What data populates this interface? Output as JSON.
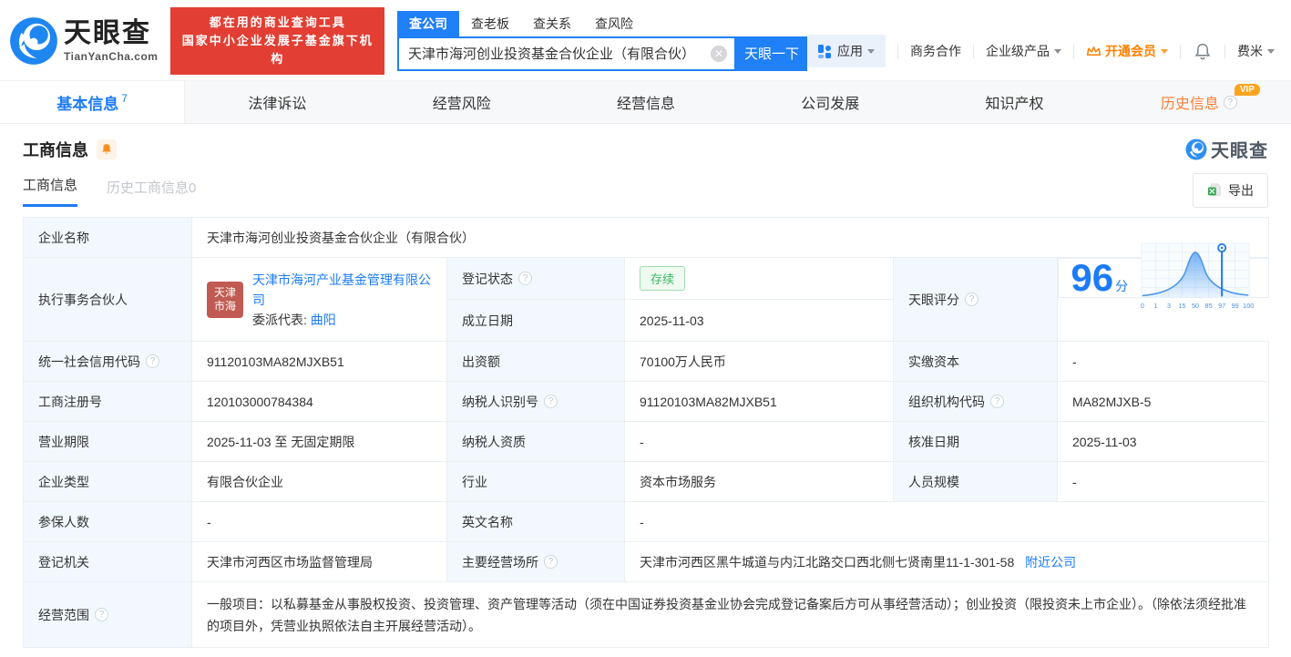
{
  "brand": {
    "name": "天眼查",
    "domain": "TianYanCha.com",
    "slogan_line1": "都在用的商业查询工具",
    "slogan_line2": "国家中小企业发展子基金旗下机构",
    "colors": {
      "primary": "#1c7bf8",
      "red": "#e23e33",
      "orange": "#ff8000",
      "green": "#3eb963"
    }
  },
  "search": {
    "tabs": [
      {
        "label": "查公司"
      },
      {
        "label": "查老板"
      },
      {
        "label": "查关系"
      },
      {
        "label": "查风险"
      }
    ],
    "value": "天津市海河创业投资基金合伙企业（有限合伙）",
    "button_label": "天眼一下"
  },
  "top_menu": {
    "apps": "应用",
    "cooperation": "商务合作",
    "enterprise_products": "企业级产品",
    "vip": "开通会员",
    "username": "费米"
  },
  "nav_tabs": [
    {
      "label": "基本信息",
      "badge": "7"
    },
    {
      "label": "法律诉讼"
    },
    {
      "label": "经营风险"
    },
    {
      "label": "经营信息"
    },
    {
      "label": "公司发展"
    },
    {
      "label": "知识产权"
    },
    {
      "label": "历史信息",
      "vip_badge": "VIP"
    }
  ],
  "section": {
    "title": "工商信息",
    "watermark": "天眼查",
    "subtab_active": "工商信息",
    "subtab_history": "历史工商信息0",
    "export_label": "导出"
  },
  "info": {
    "company_name_label": "企业名称",
    "company_name": "天津市海河创业投资基金合伙企业（有限合伙）",
    "partner_label": "执行事务合伙人",
    "partner_avatar_line1": "天津",
    "partner_avatar_line2": "市海",
    "partner_company": "天津市海河产业基金管理有限公司",
    "partner_rep_label": "委派代表:",
    "partner_rep_name": "曲阳",
    "reg_status_label": "登记状态",
    "reg_status": "存续",
    "establish_date_label": "成立日期",
    "establish_date": "2025-11-03",
    "score_label": "天眼评分",
    "score_value": "96",
    "score_unit": "分",
    "credit_code_label": "统一社会信用代码",
    "credit_code": "91120103MA82MJXB51",
    "capital_label": "出资额",
    "capital": "70100万人民币",
    "paid_capital_label": "实缴资本",
    "paid_capital": "-",
    "reg_number_label": "工商注册号",
    "reg_number": "120103000784384",
    "taxpayer_id_label": "纳税人识别号",
    "taxpayer_id": "91120103MA82MJXB51",
    "org_code_label": "组织机构代码",
    "org_code": "MA82MJXB-5",
    "business_term_label": "营业期限",
    "business_term": "2025-11-03 至 无固定期限",
    "taxpayer_quality_label": "纳税人资质",
    "taxpayer_quality": "-",
    "approval_date_label": "核准日期",
    "approval_date": "2025-11-03",
    "company_type_label": "企业类型",
    "company_type": "有限合伙企业",
    "industry_label": "行业",
    "industry": "资本市场服务",
    "staff_size_label": "人员规模",
    "staff_size": "-",
    "insured_label": "参保人数",
    "insured": "-",
    "english_name_label": "英文名称",
    "english_name": "-",
    "reg_authority_label": "登记机关",
    "reg_authority": "天津市河西区市场监督管理局",
    "business_address_label": "主要经营场所",
    "business_address": "天津市河西区黑牛城道与内江北路交口西北侧七贤南里11-1-301-58",
    "nearby_link": "附近公司",
    "business_scope_label": "经营范围",
    "business_scope": "一般项目：以私募基金从事股权投资、投资管理、资产管理等活动（须在中国证券投资基金业协会完成登记备案后方可从事经营活动）；创业投资（限投资未上市企业）。（除依法须经批准的项目外，凭营业执照依法自主开展经营活动）。"
  },
  "chart_data": {
    "type": "area",
    "title": "天眼评分",
    "score": 96,
    "xticks": [
      "0",
      "1",
      "3",
      "15",
      "50",
      "85",
      "97",
      "99",
      "100"
    ],
    "curve_peak_tick": "50",
    "marker_tick": "97",
    "grid": true
  }
}
